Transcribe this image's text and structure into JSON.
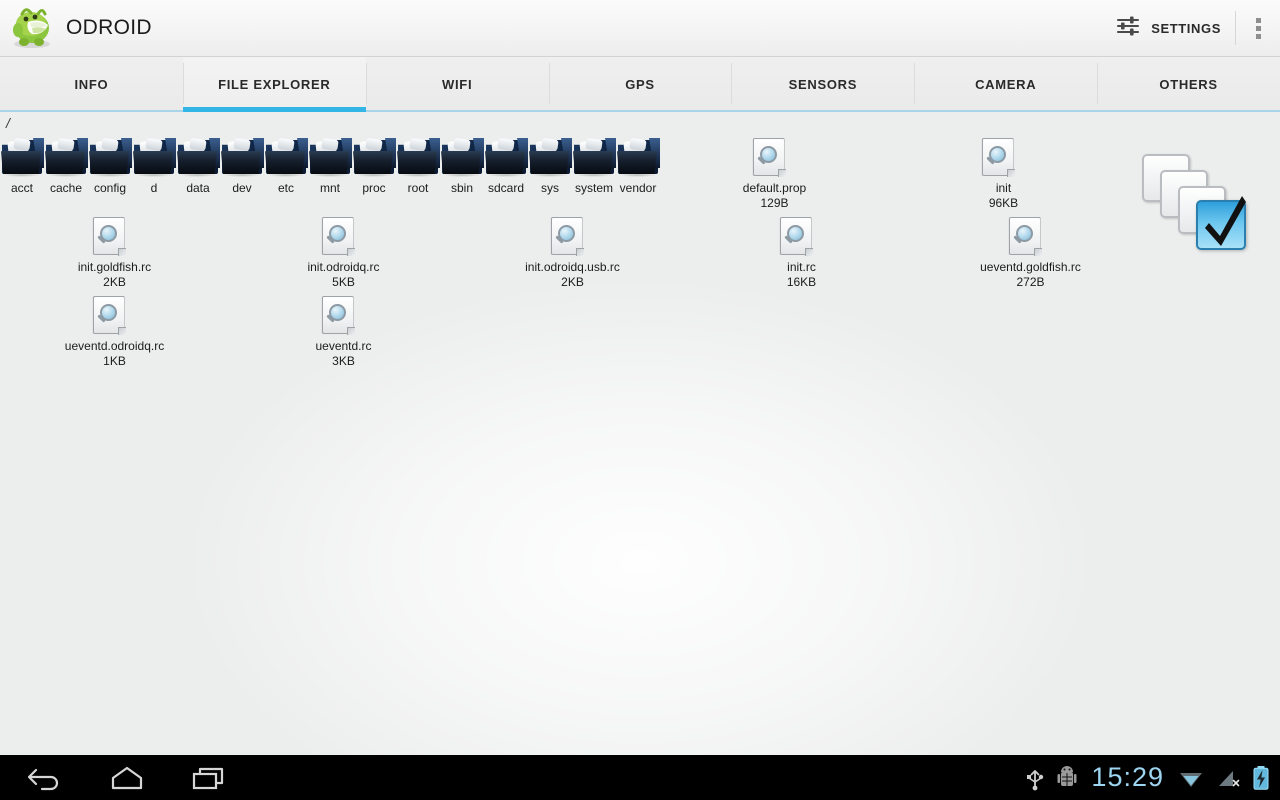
{
  "app": {
    "title": "ODROID",
    "logo_icon": "android-mascot-icon"
  },
  "actionbar": {
    "settings_label": "SETTINGS",
    "settings_icon": "sliders-icon",
    "overflow_icon": "overflow-menu-icon"
  },
  "tabs": [
    {
      "label": "INFO",
      "active": false
    },
    {
      "label": "FILE EXPLORER",
      "active": true
    },
    {
      "label": "WIFI",
      "active": false
    },
    {
      "label": "GPS",
      "active": false
    },
    {
      "label": "SENSORS",
      "active": false
    },
    {
      "label": "CAMERA",
      "active": false
    },
    {
      "label": "OTHERS",
      "active": false
    }
  ],
  "file_explorer": {
    "path": "/",
    "multiselect_icon": "select-multiple-icon",
    "entries": [
      {
        "name": "acct",
        "type": "folder",
        "size": ""
      },
      {
        "name": "cache",
        "type": "folder",
        "size": ""
      },
      {
        "name": "config",
        "type": "folder",
        "size": ""
      },
      {
        "name": "d",
        "type": "folder",
        "size": ""
      },
      {
        "name": "data",
        "type": "folder",
        "size": ""
      },
      {
        "name": "dev",
        "type": "folder",
        "size": ""
      },
      {
        "name": "etc",
        "type": "folder",
        "size": ""
      },
      {
        "name": "mnt",
        "type": "folder",
        "size": ""
      },
      {
        "name": "proc",
        "type": "folder",
        "size": ""
      },
      {
        "name": "root",
        "type": "folder",
        "size": ""
      },
      {
        "name": "sbin",
        "type": "folder",
        "size": ""
      },
      {
        "name": "sdcard",
        "type": "folder",
        "size": ""
      },
      {
        "name": "sys",
        "type": "folder",
        "size": ""
      },
      {
        "name": "system",
        "type": "folder",
        "size": ""
      },
      {
        "name": "vendor",
        "type": "folder",
        "size": ""
      },
      {
        "name": "default.prop",
        "type": "file",
        "size": "129B"
      },
      {
        "name": "init",
        "type": "file",
        "size": "96KB"
      },
      {
        "name": "init.goldfish.rc",
        "type": "file",
        "size": "2KB"
      },
      {
        "name": "init.odroidq.rc",
        "type": "file",
        "size": "5KB"
      },
      {
        "name": "init.odroidq.usb.rc",
        "type": "file",
        "size": "2KB"
      },
      {
        "name": "init.rc",
        "type": "file",
        "size": "16KB"
      },
      {
        "name": "ueventd.goldfish.rc",
        "type": "file",
        "size": "272B"
      },
      {
        "name": "ueventd.odroidq.rc",
        "type": "file",
        "size": "1KB"
      },
      {
        "name": "ueventd.rc",
        "type": "file",
        "size": "3KB"
      }
    ]
  },
  "systembar": {
    "back_icon": "back-arrow-icon",
    "home_icon": "home-icon",
    "recents_icon": "recent-apps-icon",
    "usb_icon": "usb-icon",
    "adb_icon": "android-debug-icon",
    "clock": "15:29",
    "wifi_icon": "wifi-icon",
    "signal_icon": "no-signal-icon",
    "battery_icon": "battery-charging-icon"
  },
  "colors": {
    "accent": "#33b5e5",
    "tab_line": "#a8d5ea",
    "clock": "#9dd4ef",
    "content_bg": "#eceded"
  }
}
